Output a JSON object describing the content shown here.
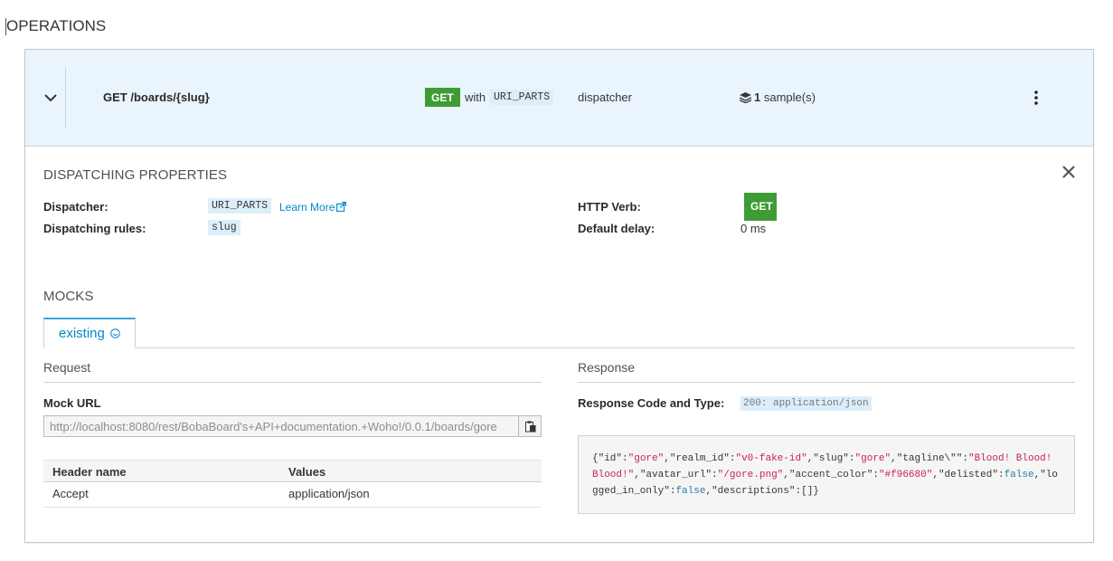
{
  "page": {
    "title": "OPERATIONS"
  },
  "operation": {
    "name": "GET /boards/{slug}",
    "verb": "GET",
    "with_text": "with",
    "dispatcher": "URI_PARTS",
    "dispatcher_suffix": "dispatcher",
    "samples_count": "1",
    "samples_label": "sample(s)"
  },
  "dispatching": {
    "title": "DISPATCHING PROPERTIES",
    "dispatcher_label": "Dispatcher:",
    "dispatcher_value": "URI_PARTS",
    "learn_more": "Learn More",
    "rules_label": "Dispatching rules:",
    "rules_value": "slug",
    "verb_label": "HTTP Verb:",
    "verb_value": "GET",
    "delay_label": "Default delay:",
    "delay_value": "0 ms"
  },
  "mocks": {
    "title": "MOCKS",
    "tab_label": "existing",
    "request": {
      "heading": "Request",
      "mock_url_label": "Mock URL",
      "mock_url": "http://localhost:8080/rest/BobaBoard's+API+documentation.+Woho!/0.0.1/boards/gore",
      "headers_columns": [
        "Header name",
        "Values"
      ],
      "headers_rows": [
        {
          "name": "Accept",
          "value": "application/json"
        }
      ]
    },
    "response": {
      "heading": "Response",
      "code_label": "Response Code and Type:",
      "code_value": "200: application/json",
      "body_tokens": [
        [
          "p",
          "{"
        ],
        [
          "p",
          "\"id\""
        ],
        [
          "p",
          ":"
        ],
        [
          "s",
          "\"gore\""
        ],
        [
          "p",
          ","
        ],
        [
          "p",
          "\"realm_id\""
        ],
        [
          "p",
          ":"
        ],
        [
          "s",
          "\"v0-fake-id\""
        ],
        [
          "p",
          ","
        ],
        [
          "p",
          "\"slug\""
        ],
        [
          "p",
          ":"
        ],
        [
          "s",
          "\"gore\""
        ],
        [
          "p",
          ","
        ],
        [
          "p",
          "\"tagline\\\"\""
        ],
        [
          "p",
          ":"
        ],
        [
          "s",
          "\"Blood! Blood! Blood!\""
        ],
        [
          "p",
          ","
        ],
        [
          "p",
          "\"avatar_url\""
        ],
        [
          "p",
          ":"
        ],
        [
          "s",
          "\"/gore.png\""
        ],
        [
          "p",
          ","
        ],
        [
          "p",
          "\"accent_color\""
        ],
        [
          "p",
          ":"
        ],
        [
          "s",
          "\"#f96680\""
        ],
        [
          "p",
          ","
        ],
        [
          "p",
          "\"delisted\""
        ],
        [
          "p",
          ":"
        ],
        [
          "b",
          "false"
        ],
        [
          "p",
          ","
        ],
        [
          "p",
          "\"logged_in_only\""
        ],
        [
          "p",
          ":"
        ],
        [
          "b",
          "false"
        ],
        [
          "p",
          ","
        ],
        [
          "p",
          "\"descriptions\""
        ],
        [
          "p",
          ":"
        ],
        [
          "p",
          "[]"
        ],
        [
          "p",
          "}"
        ]
      ]
    }
  },
  "colors": {
    "verb_badge": "#3f9c35",
    "header_bg": "#eaf4fc",
    "link": "#0088ce",
    "json_string": "#c7254e",
    "json_bool": "#2a7fa3"
  },
  "icons": {
    "expand": "chevron-down-icon",
    "menu": "kebab-menu-icon",
    "samples": "layers-icon",
    "close": "close-icon",
    "copy": "clipboard-icon",
    "external": "external-link-icon",
    "tab": "smiley-icon"
  }
}
